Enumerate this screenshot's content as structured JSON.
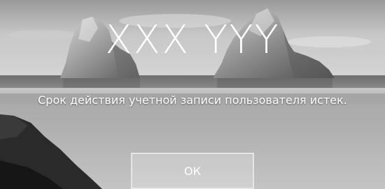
{
  "lock_screen": {
    "username": "XXX YYY",
    "message": "Срок действия учетной записи пользователя истек.",
    "ok_label": "ОК"
  },
  "wallpaper": {
    "scene": "beach with sea stacks",
    "palette": [
      "#d9d9d9",
      "#bdbdbd",
      "#8c8c8c",
      "#4a4a4a",
      "#1f1f1f"
    ]
  }
}
